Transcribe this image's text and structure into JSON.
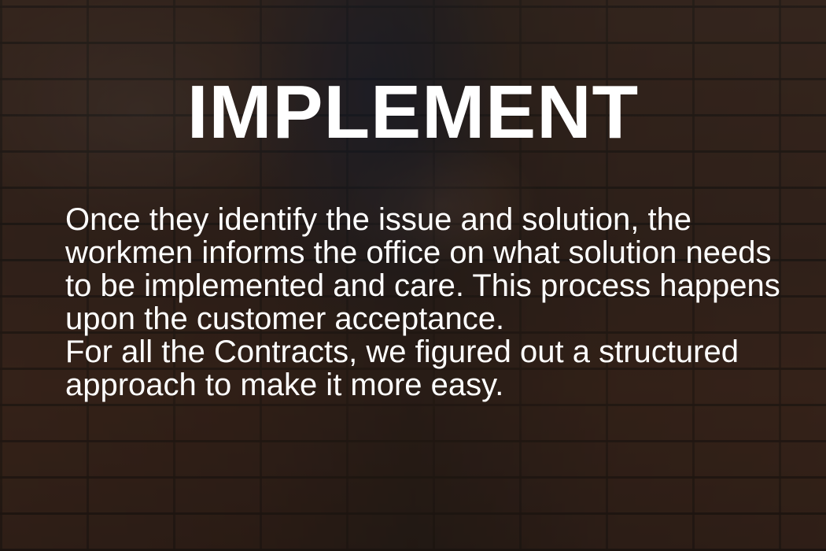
{
  "slide": {
    "title": "IMPLEMENT",
    "paragraphs": [
      "Once they identify the issue and solution, the workmen informs the office on what solution needs to be implemented and care. This process happens upon the customer acceptance.",
      "For all the Contracts, we figured out a structured approach to make it more easy."
    ]
  }
}
